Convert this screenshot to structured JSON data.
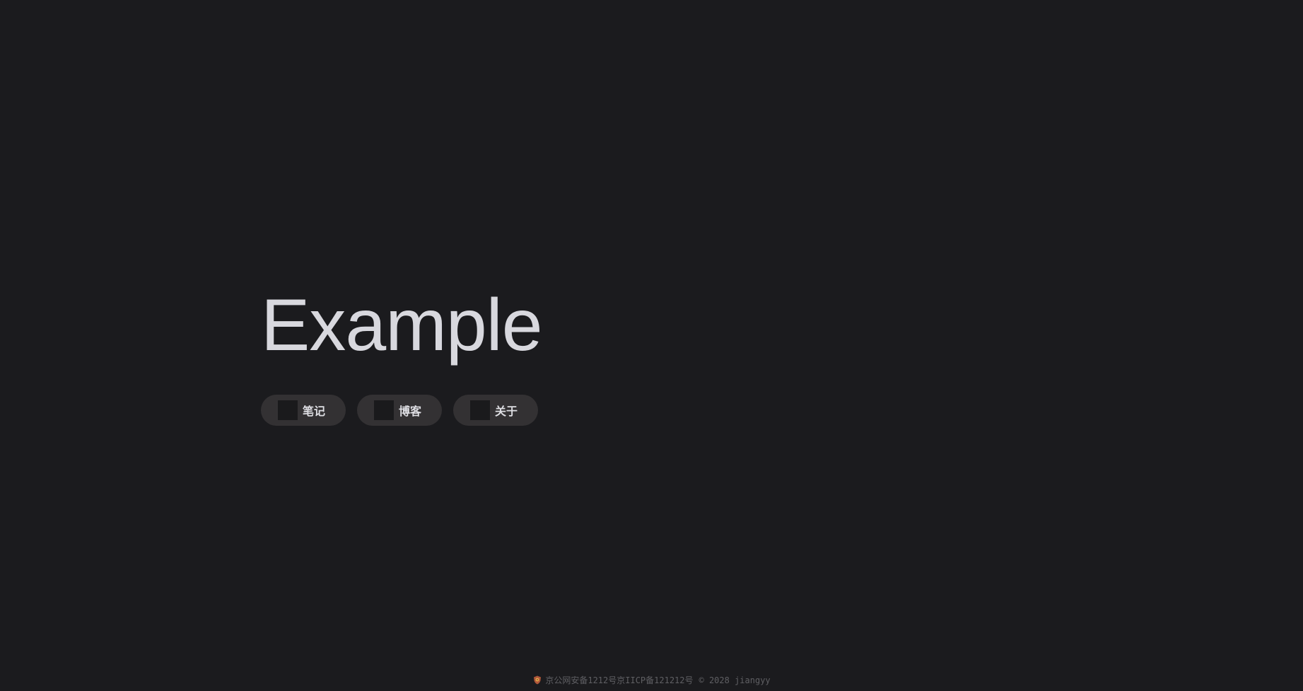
{
  "hero": {
    "title": "Example"
  },
  "nav": {
    "items": [
      {
        "label": "笔记",
        "icon": "notes-icon"
      },
      {
        "label": "博客",
        "icon": "blog-icon"
      },
      {
        "label": "关于",
        "icon": "about-icon"
      }
    ]
  },
  "footer": {
    "police_icon": "police-badge-icon",
    "public_security_record": "京公网安备1212号",
    "icp_record": "京IICP备121212号",
    "copyright": "© 2028 jiangyy"
  },
  "colors": {
    "background": "#1b1b1e",
    "button_background": "#333133",
    "title_text": "#d8d8de",
    "footer_text": "#5f5f63"
  }
}
